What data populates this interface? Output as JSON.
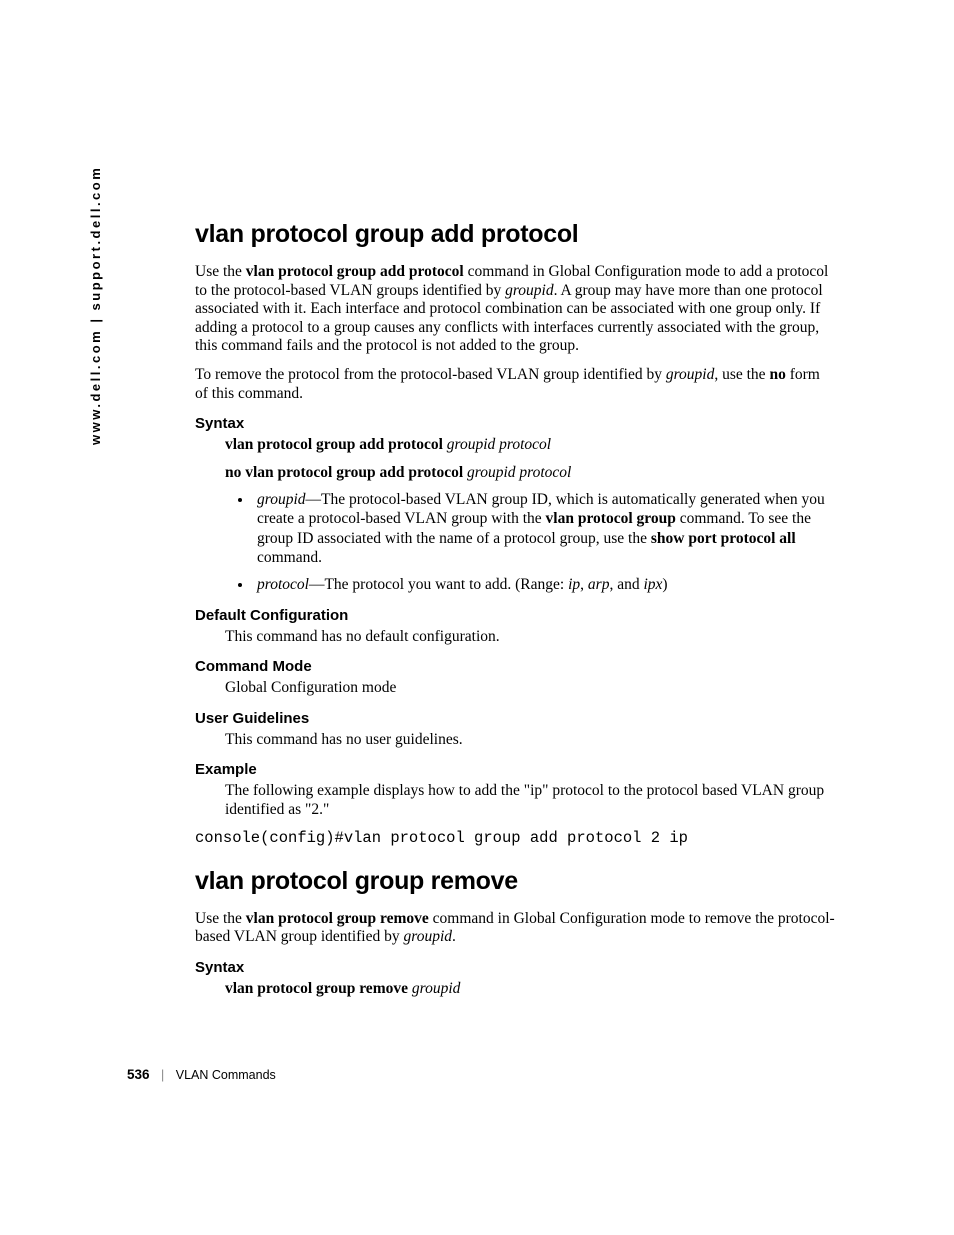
{
  "sidebar": {
    "url": "www.dell.com | support.dell.com"
  },
  "section1": {
    "heading": "vlan protocol group add protocol",
    "para1_pre": "Use the ",
    "para1_cmd": "vlan protocol group add protocol",
    "para1_mid1": " command in Global Configuration mode to add a protocol to the protocol-based VLAN groups identified by ",
    "para1_gid": "groupid",
    "para1_post": ". A group may have more than one protocol associated with it. Each interface and protocol combination can be associated with one group only. If adding a protocol to a group causes any conflicts with interfaces currently associated with the group, this command fails and the protocol is not added to the group.",
    "para2_pre": "To remove the protocol from the protocol-based VLAN group identified by ",
    "para2_gid": "groupid",
    "para2_mid": ", use the ",
    "para2_no": "no",
    "para2_post": " form of this command.",
    "syntax_label": "Syntax",
    "syntax_l1_cmd": "vlan protocol group add protocol",
    "syntax_l1_args": "groupid protocol",
    "syntax_l2_cmd": "no vlan protocol group add protocol",
    "syntax_l2_args": "groupid protocol",
    "bullet1_term": "groupid",
    "bullet1_mid1": "—The protocol-based VLAN group ID, which is automatically generated when you create a protocol-based VLAN group with the ",
    "bullet1_cmd1": "vlan protocol group",
    "bullet1_mid2": " command. To see the group ID associated with the name of a protocol group, use the ",
    "bullet1_cmd2": "show port protocol all",
    "bullet1_post": " command.",
    "bullet2_term": "protocol",
    "bullet2_mid1": "—The protocol you want to add. (Range: ",
    "bullet2_i1": "ip",
    "bullet2_c1": ", ",
    "bullet2_i2": "arp",
    "bullet2_c2": ", and ",
    "bullet2_i3": "ipx",
    "bullet2_post": ")",
    "defcfg_label": "Default Configuration",
    "defcfg_text": "This command has no default configuration.",
    "cmdmode_label": "Command Mode",
    "cmdmode_text": "Global Configuration mode",
    "userg_label": "User Guidelines",
    "userg_text": "This command has no user guidelines.",
    "example_label": "Example",
    "example_text": "The following example displays how to add the \"ip\" protocol to the protocol based VLAN group identified as \"2.\"",
    "example_code": "console(config)#vlan protocol group add protocol 2 ip"
  },
  "section2": {
    "heading": "vlan protocol group remove",
    "para1_pre": "Use the ",
    "para1_cmd": "vlan protocol group remove",
    "para1_mid1": " command in Global Configuration mode to remove the protocol-based VLAN group identified by ",
    "para1_gid": "groupid",
    "para1_post": ".",
    "syntax_label": "Syntax",
    "syntax_l1_cmd": "vlan protocol group remove",
    "syntax_l1_args": "groupid"
  },
  "footer": {
    "page": "536",
    "separator": "|",
    "chapter": "VLAN Commands"
  }
}
